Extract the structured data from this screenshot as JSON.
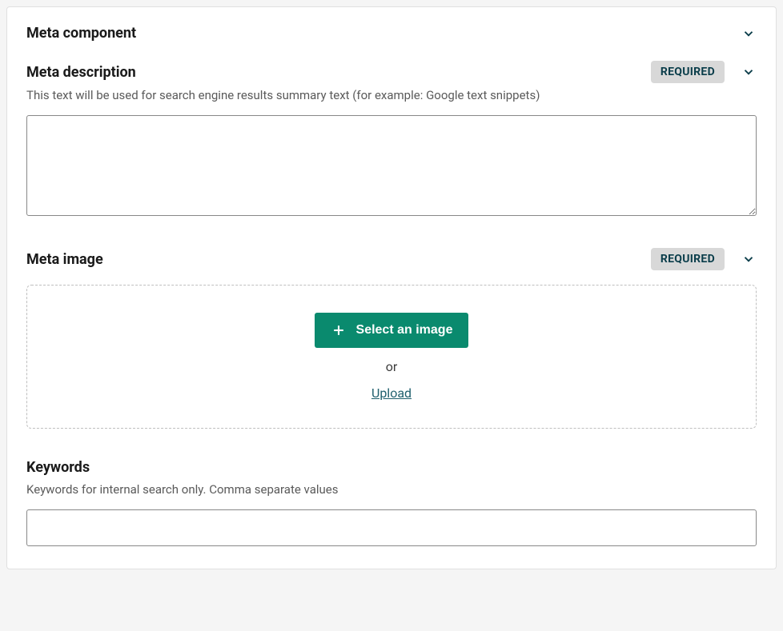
{
  "badges": {
    "required": "REQUIRED"
  },
  "meta_component": {
    "title": "Meta component"
  },
  "meta_description": {
    "title": "Meta description",
    "help": "This text will be used for search engine results summary text (for example: Google text snippets)",
    "value": ""
  },
  "meta_image": {
    "title": "Meta image",
    "select_button": "Select an image",
    "or_text": "or",
    "upload_link": "Upload"
  },
  "keywords": {
    "title": "Keywords",
    "help": "Keywords for internal search only. Comma separate values",
    "value": ""
  }
}
